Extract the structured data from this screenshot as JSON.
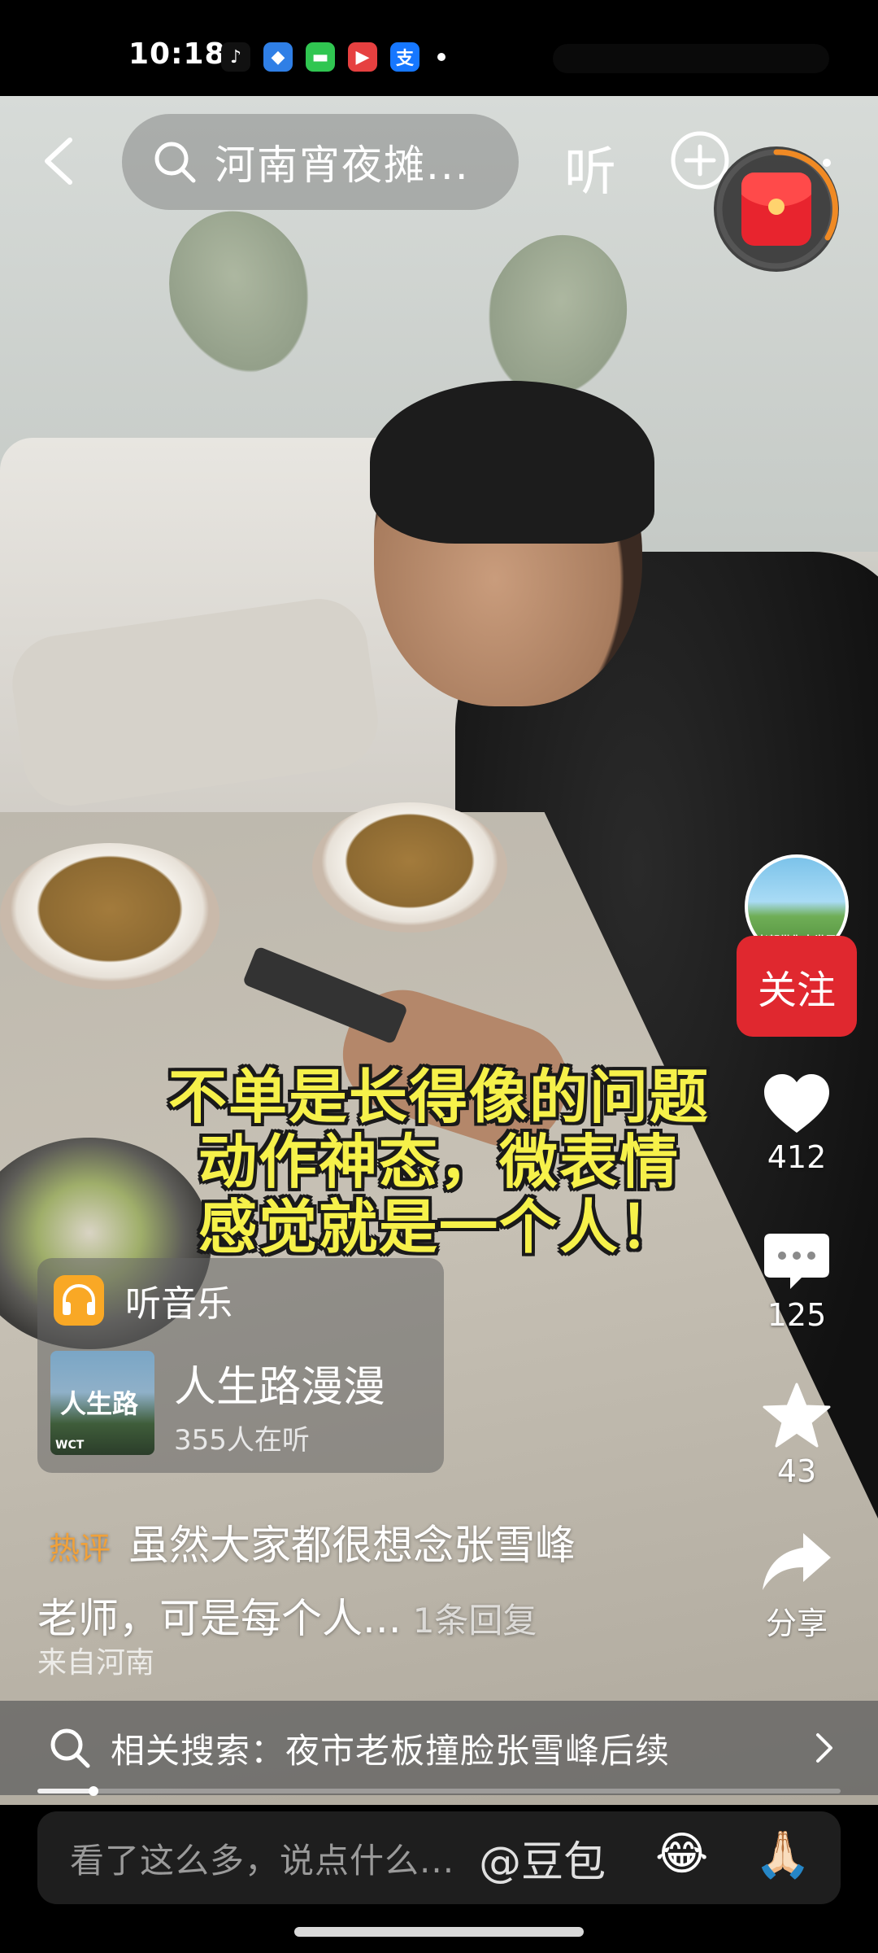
{
  "status_bar": {
    "time": "10:18",
    "apps": [
      {
        "icon": "tiktok-icon",
        "glyph": "♪",
        "bg": "#111111",
        "fg": "#ffffff"
      },
      {
        "icon": "browser-icon",
        "glyph": "◆",
        "bg": "#2f7fe6",
        "fg": "#ffffff"
      },
      {
        "icon": "messages-icon",
        "glyph": "▬",
        "bg": "#30c651",
        "fg": "#ffffff"
      },
      {
        "icon": "video-app-icon",
        "glyph": "▶",
        "bg": "#e64040",
        "fg": "#ffffff"
      },
      {
        "icon": "alipay-icon",
        "glyph": "支",
        "bg": "#1677ff",
        "fg": "#ffffff"
      }
    ]
  },
  "top_bar": {
    "search_text": "河南宵夜摊...",
    "listen_label": "听"
  },
  "subtitle": {
    "lines": [
      "不单是长得像的问题",
      "动作神态，微表情",
      "感觉就是一个人！"
    ]
  },
  "actions": {
    "follow_label": "关注",
    "avatar_label": "老郭带你去世界",
    "likes": "412",
    "comments": "125",
    "favorites": "43",
    "share_label": "分享"
  },
  "music": {
    "header": "听音乐",
    "album_art_text": "人生路",
    "album_logo": "WCT",
    "song_title": "人生路漫漫",
    "listeners": "355人在听"
  },
  "hot_comment": {
    "tag": "热评",
    "text_line1": "虽然大家都很想念张雪峰",
    "text_line2": "老师，可是每个人...",
    "reply_count": "1条回复",
    "origin": "来自河南"
  },
  "related": {
    "label": "相关搜索：夜市老板撞脸张雪峰后续"
  },
  "progress": {
    "fraction": 0.07
  },
  "comment_bar": {
    "placeholder": "看了这么多，说点什么...",
    "mention": "@豆包",
    "emoji_1": "😂",
    "emoji_2": "🙏🏻"
  },
  "colors": {
    "follow_red": "#e0282f",
    "subtitle_yellow": "#f6f14a",
    "hot_tag_orange": "#f0a13a"
  }
}
